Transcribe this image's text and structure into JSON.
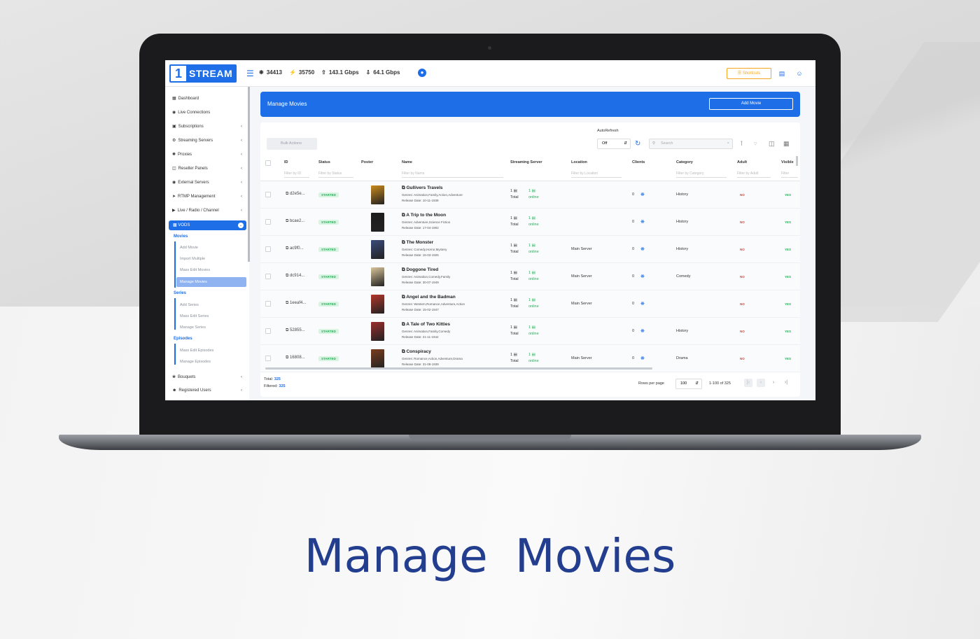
{
  "brand": {
    "logo_number": "1",
    "logo_text": "STREAM"
  },
  "topbar": {
    "stats": [
      {
        "icon": "network-icon",
        "value": "34413"
      },
      {
        "icon": "bolt-icon",
        "value": "35750"
      },
      {
        "icon": "upload-icon",
        "value": "143.1 Gbps"
      },
      {
        "icon": "download-icon",
        "value": "64.1 Gbps"
      }
    ],
    "shortcuts_label": "Shortcuts"
  },
  "sidebar": {
    "items": [
      {
        "label": "Dashboard",
        "icon": "grid-icon",
        "chevron": false
      },
      {
        "label": "Live Connections",
        "icon": "eye-icon",
        "chevron": false
      },
      {
        "label": "Subscriptions",
        "icon": "cart-icon",
        "chevron": true
      },
      {
        "label": "Streaming Servers",
        "icon": "server-icon",
        "chevron": true
      },
      {
        "label": "Proxies",
        "icon": "proxy-icon",
        "chevron": true
      },
      {
        "label": "Reseller Panels",
        "icon": "panel-icon",
        "chevron": true
      },
      {
        "label": "External Servers",
        "icon": "globe-icon",
        "chevron": true
      },
      {
        "label": "RTMP Management",
        "icon": "rtmp-icon",
        "chevron": true
      },
      {
        "label": "Live / Radio / Channel",
        "icon": "play-icon",
        "chevron": true
      }
    ],
    "active_section": "VODS",
    "groups": [
      {
        "label": "Movies",
        "subs": [
          "Add Movie",
          "Import Multiple",
          "Mass Edit Movies",
          "Manage Movies"
        ]
      },
      {
        "label": "Series",
        "subs": [
          "Add Series",
          "Mass Edit Series",
          "Manage Series"
        ]
      },
      {
        "label": "Episodes",
        "subs": [
          "Mass Edit Episodes",
          "Manage Episodes"
        ]
      }
    ],
    "bottom_items": [
      {
        "label": "Bouquets",
        "icon": "bouquet-icon"
      },
      {
        "label": "Registered Users",
        "icon": "user-icon"
      }
    ]
  },
  "page": {
    "title": "Manage Movies",
    "add_button": "Add Movie"
  },
  "toolbar": {
    "bulk_actions": "Bulk Actions",
    "autorefresh_label": "AutoRefresh",
    "autorefresh_value": "Off",
    "search_placeholder": "Search"
  },
  "table": {
    "columns": [
      {
        "label": "ID",
        "filter": "Filter by ID"
      },
      {
        "label": "Status",
        "filter": "Filter by Status"
      },
      {
        "label": "Poster",
        "filter": ""
      },
      {
        "label": "Name",
        "filter": "Filter by Name"
      },
      {
        "label": "Streaming Server",
        "filter": ""
      },
      {
        "label": "Location",
        "filter": "Filter by Location"
      },
      {
        "label": "Clients",
        "filter": ""
      },
      {
        "label": "Category",
        "filter": "Filter by Category"
      },
      {
        "label": "Adult",
        "filter": "Filter by Adult"
      },
      {
        "label": "Visible",
        "filter": "Filter"
      }
    ],
    "rows": [
      {
        "id": "d2e5e...",
        "status": "STARTED",
        "name": "Gullivers Travels",
        "genres": "Genres: Animation,Family,Action,Adventure",
        "release": "Release Date: 10-11-1939",
        "total": "1",
        "online": "1",
        "location": "",
        "clients": "0",
        "category": "History",
        "adult": "NO",
        "visible": "YES",
        "poster_color": "#c98a1c"
      },
      {
        "id": "bcae2...",
        "status": "STARTED",
        "name": "A Trip to the Moon",
        "genres": "Genres: Adventure,Science Fiction",
        "release": "Release Date: 17-04-1902",
        "total": "1",
        "online": "1",
        "location": "",
        "clients": "0",
        "category": "History",
        "adult": "NO",
        "visible": "YES",
        "poster_color": "#1c1c1c"
      },
      {
        "id": "ac9f0...",
        "status": "STARTED",
        "name": "The Monster",
        "genres": "Genres: Comedy,Horror,Mystery",
        "release": "Release Date: 15-03-1925",
        "total": "1",
        "online": "1",
        "location": "Main Server",
        "clients": "0",
        "category": "History",
        "adult": "NO",
        "visible": "YES",
        "poster_color": "#3b4a7a"
      },
      {
        "id": "dc914...",
        "status": "STARTED",
        "name": "Doggone Tired",
        "genres": "Genres: Animation,Comedy,Family",
        "release": "Release Date: 30-07-1949",
        "total": "1",
        "online": "1",
        "location": "Main Server",
        "clients": "0",
        "category": "Comedy",
        "adult": "NO",
        "visible": "YES",
        "poster_color": "#d8c49a"
      },
      {
        "id": "1eeaf4...",
        "status": "STARTED",
        "name": "Angel and the Badman",
        "genres": "Genres: Western,Romance,Adventure,Action",
        "release": "Release Date: 15-02-1947",
        "total": "1",
        "online": "1",
        "location": "Main Server",
        "clients": "0",
        "category": "",
        "adult": "NO",
        "visible": "YES",
        "poster_color": "#b2362b"
      },
      {
        "id": "52855...",
        "status": "STARTED",
        "name": "A Tale of Two Kitties",
        "genres": "Genres: Animation,Family,Comedy",
        "release": "Release Date: 21-11-1942",
        "total": "1",
        "online": "1",
        "location": "",
        "clients": "0",
        "category": "History",
        "adult": "NO",
        "visible": "YES",
        "poster_color": "#9b2d2d"
      },
      {
        "id": "16808...",
        "status": "STARTED",
        "name": "Conspiracy",
        "genres": "Genres: Romance,Action,Adventure,Drama",
        "release": "Release Date: 31-08-1939",
        "total": "1",
        "online": "1",
        "location": "Main Server",
        "clients": "0",
        "category": "Drama",
        "adult": "NO",
        "visible": "YES",
        "poster_color": "#7a3d1e"
      }
    ],
    "total_label": "Total:",
    "total_value": "325",
    "filtered_label": "Filtered:",
    "filtered_value": "325",
    "rows_per_page_label": "Rows per page",
    "rows_per_page": "100",
    "range": "1-100 of 325"
  },
  "headline": "Manage Movies"
}
